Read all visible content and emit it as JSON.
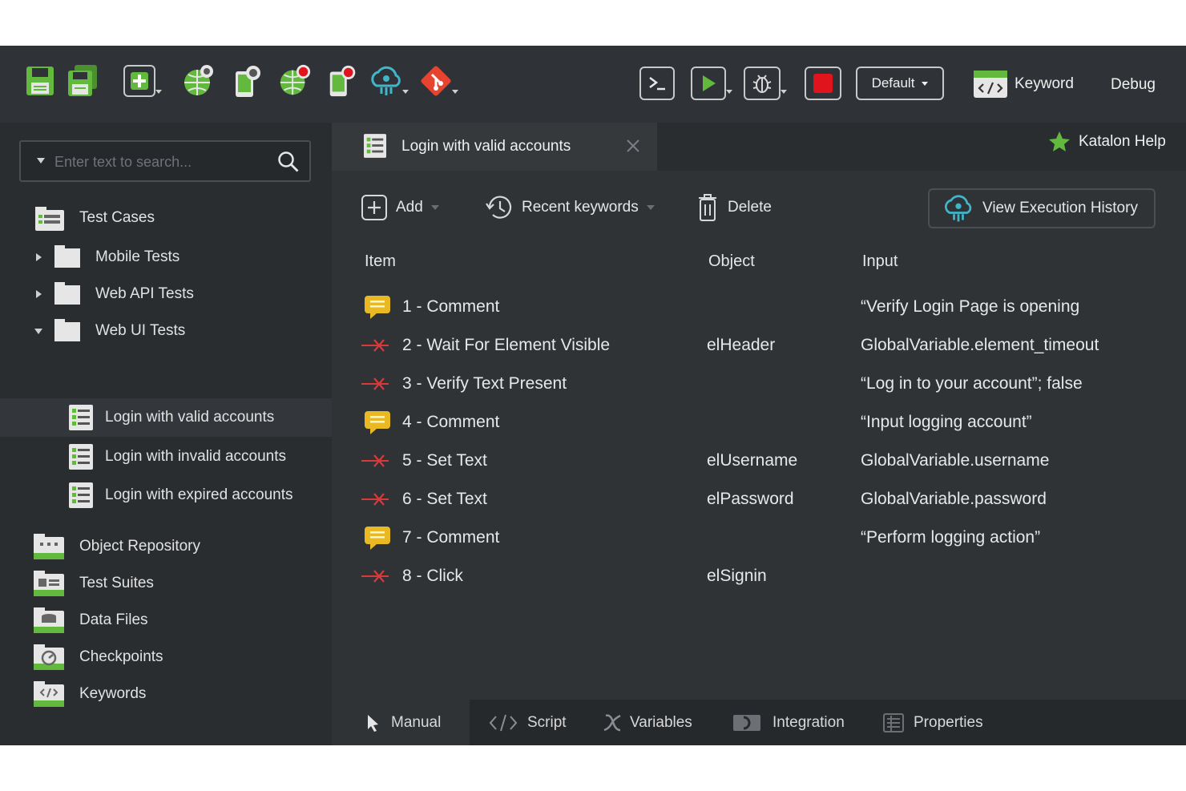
{
  "toolbar": {
    "icons": [
      "save-icon",
      "save-all-icon",
      "new-icon",
      "spy-web-icon",
      "spy-mobile-icon",
      "record-web-icon",
      "record-mobile-icon",
      "katalon-cloud-icon",
      "git-icon"
    ],
    "right_icons": [
      "console-icon",
      "run-icon",
      "debug-run-icon",
      "stop-icon"
    ],
    "profile_label": "Default",
    "perspective_keyword": "Keyword",
    "perspective_debug": "Debug"
  },
  "search": {
    "placeholder": "Enter text to search..."
  },
  "tree": {
    "root": "Test Cases",
    "folders": [
      {
        "label": "Mobile Tests",
        "state": "collapsed"
      },
      {
        "label": "Web API Tests",
        "state": "collapsed"
      },
      {
        "label": "Web UI Tests",
        "state": "expanded"
      }
    ],
    "test_cases": [
      {
        "label": "Login with valid accounts",
        "selected": true
      },
      {
        "label": "Login with invalid accounts",
        "selected": false
      },
      {
        "label": "Login with expired accounts",
        "selected": false
      }
    ],
    "sections": [
      {
        "label": "Object Repository",
        "icon": "object-repository-icon"
      },
      {
        "label": "Test Suites",
        "icon": "test-suites-icon"
      },
      {
        "label": "Data Files",
        "icon": "data-files-icon"
      },
      {
        "label": "Checkpoints",
        "icon": "checkpoints-icon"
      },
      {
        "label": "Keywords",
        "icon": "keywords-icon"
      }
    ]
  },
  "editor": {
    "tab_title": "Login with valid accounts",
    "help_label": "Katalon Help",
    "actions": {
      "add": "Add",
      "recent": "Recent keywords",
      "delete": "Delete",
      "history": "View Execution History"
    },
    "columns": {
      "item": "Item",
      "object": "Object",
      "input": "Input"
    },
    "steps": [
      {
        "type": "comment",
        "item": "1 - Comment",
        "object": "",
        "input": "“Verify Login Page is opening"
      },
      {
        "type": "keyword",
        "item": "2 - Wait For Element Visible",
        "object": "elHeader",
        "input": "GlobalVariable.element_timeout"
      },
      {
        "type": "keyword",
        "item": "3 - Verify Text Present",
        "object": "",
        "input": "“Log in to your account”; false"
      },
      {
        "type": "comment",
        "item": "4 - Comment",
        "object": "",
        "input": "“Input logging account”"
      },
      {
        "type": "keyword",
        "item": "5 - Set Text",
        "object": "elUsername",
        "input": "GlobalVariable.username"
      },
      {
        "type": "keyword",
        "item": "6 - Set Text",
        "object": "elPassword",
        "input": "GlobalVariable.password"
      },
      {
        "type": "comment",
        "item": "7 - Comment",
        "object": "",
        "input": "“Perform logging action”"
      },
      {
        "type": "keyword",
        "item": "8 - Click",
        "object": "elSignin",
        "input": ""
      }
    ],
    "bottom_tabs": [
      {
        "label": "Manual",
        "icon": "cursor-icon",
        "active": true
      },
      {
        "label": "Script",
        "icon": "code-icon",
        "active": false
      },
      {
        "label": "Variables",
        "icon": "variable-icon",
        "active": false
      },
      {
        "label": "Integration",
        "icon": "integration-icon",
        "active": false
      },
      {
        "label": "Properties",
        "icon": "properties-icon",
        "active": false
      }
    ]
  },
  "colors": {
    "accent_green": "#5cb83a",
    "keyword_red": "#d9393b",
    "comment_yellow": "#e8b923",
    "stop_red": "#e0141c"
  }
}
